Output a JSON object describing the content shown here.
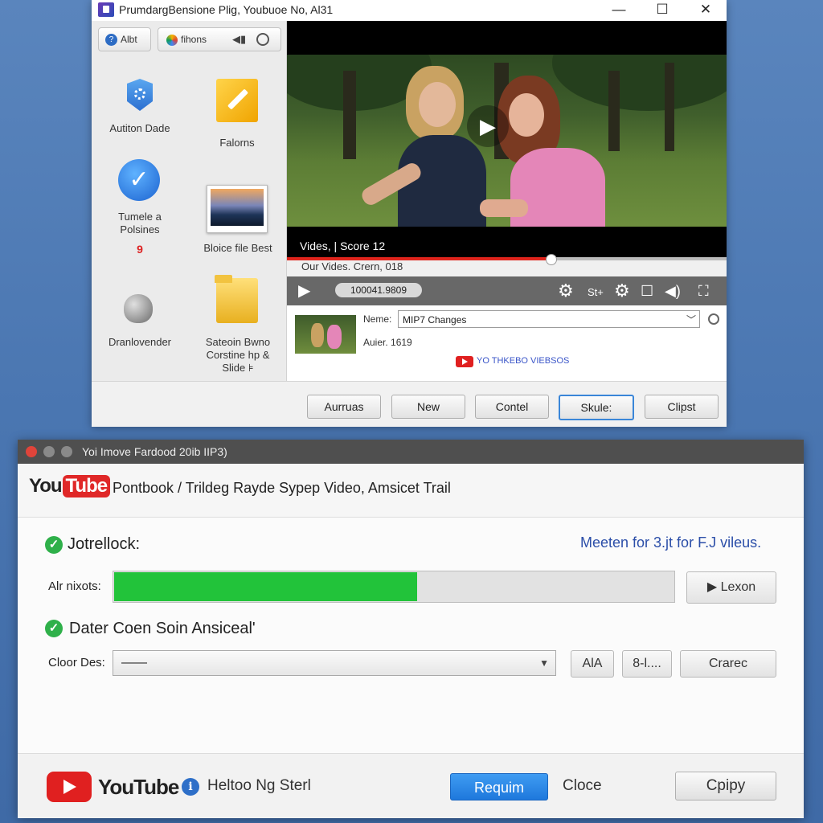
{
  "top_window": {
    "title": "PrumdargBensione Plig, Youbuoe No, Al31",
    "controls": {
      "minimize": "—",
      "maximize": "☐",
      "close": "✕"
    },
    "toolbar": {
      "chip1": "Albt",
      "chip2": "fihons"
    },
    "sidebar_items": [
      {
        "label": "Autiton Dade",
        "icon": "gear-badge-icon"
      },
      {
        "label": "Falorns",
        "icon": "edit-pencil-icon"
      },
      {
        "label": "Tumele a Polsines",
        "sub": "9",
        "icon": "checkmark-circle-icon"
      },
      {
        "label": "Bloice file Best",
        "icon": "landscape-photo-icon"
      },
      {
        "label": "Dranlovender",
        "icon": "apple-icon"
      },
      {
        "label": "Sateoin Bwno Corstine hp & Slide ⊧",
        "icon": "folder-icon"
      }
    ],
    "video": {
      "caption": "Vides, | Score 12",
      "subtitle": "Our Vides. Crern, 018",
      "progress": 0.6,
      "time": "100041.9809",
      "settings_text": "St+"
    },
    "info": {
      "name_label": "Neme:",
      "name_value": "MIP7 Changes",
      "author_label": "Auier. 1619",
      "link": "YO THKEBO VIEBSOS"
    },
    "buttons": [
      "Aurruas",
      "New",
      "Contel",
      "Skule:",
      "Clipst"
    ]
  },
  "bottom_window": {
    "title": "Yoi Imove Fardood 20ib IIP3)",
    "logo": {
      "you": "You",
      "tube": "Tube"
    },
    "heading": "Pontbook / Trildeg Rayde Sypep Video, Amsicet Trail",
    "section1": {
      "label": "Jotrellock:",
      "link": "Meeten for 3.jt for F.J vileus.",
      "row_label": "Alr nixots:",
      "progress": 0.54,
      "progress_color": "#22c33a",
      "button": "▶ Lexon"
    },
    "section2": {
      "label": "Dater Coen Soin Ansiceal'",
      "row_label": "Cloor Des:",
      "dropdown_value": "——",
      "btn1": "AlA",
      "btn2": "8-l....",
      "btn3": "Crarec"
    },
    "footer": {
      "brand": "YouTube",
      "help_text": "Heltoo Ng Sterl",
      "primary": "Requim",
      "plain": "Cloce",
      "secondary": "Cpipy"
    }
  },
  "colors": {
    "accent_blue": "#1e78dc",
    "youtube_red": "#e02020",
    "success_green": "#2fb04a"
  }
}
